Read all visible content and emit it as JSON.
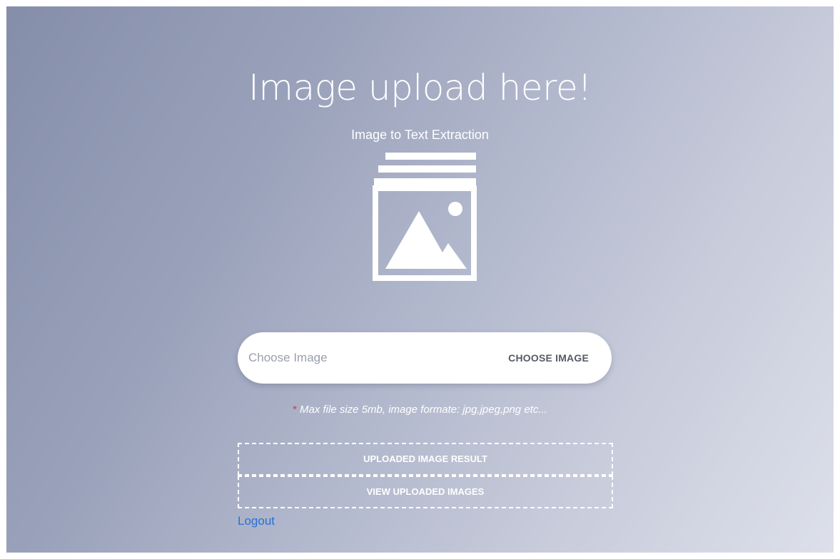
{
  "page": {
    "title": "Image upload here!",
    "subtitle": "Image to Text Extraction"
  },
  "hero_icon": "image-gallery-icon",
  "upload": {
    "placeholder": "Choose Image",
    "button_label": "CHOOSE IMAGE"
  },
  "note": {
    "asterisk": "*",
    "text": "Max file size 5mb, image formate: jpg,jpeg,png etc..."
  },
  "actions": {
    "result_label": "UPLOADED IMAGE RESULT",
    "view_label": "VIEW UPLOADED IMAGES"
  },
  "logout_label": "Logout",
  "colors": {
    "background_start": "#858ea9",
    "background_end": "#dde0ea",
    "link": "#2a6fd6",
    "asterisk": "#d33a3a"
  }
}
